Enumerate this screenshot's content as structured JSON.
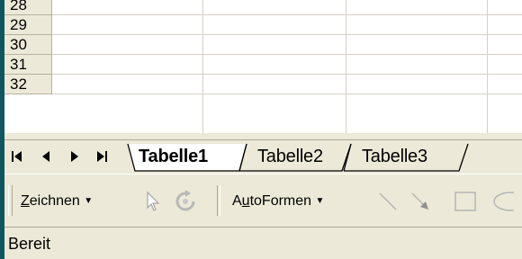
{
  "grid": {
    "rows": [
      "28",
      "29",
      "30",
      "31",
      "32"
    ]
  },
  "sheet_tabs": {
    "nav_buttons": [
      "first-sheet",
      "previous-sheet",
      "next-sheet",
      "last-sheet"
    ],
    "tabs": [
      {
        "label": "Tabelle1",
        "active": true
      },
      {
        "label": "Tabelle2",
        "active": false
      },
      {
        "label": "Tabelle3",
        "active": false
      }
    ]
  },
  "drawing_toolbar": {
    "draw_menu": {
      "prefix": "",
      "accel": "Z",
      "rest": "eichnen"
    },
    "autoshapes_menu": {
      "prefix": "A",
      "accel": "u",
      "rest": "toFormen"
    },
    "tools": [
      "select-objects-icon",
      "free-rotate-icon",
      "line-icon",
      "arrow-icon",
      "rectangle-icon",
      "oval-icon"
    ]
  },
  "status_bar": {
    "text": "Bereit"
  }
}
